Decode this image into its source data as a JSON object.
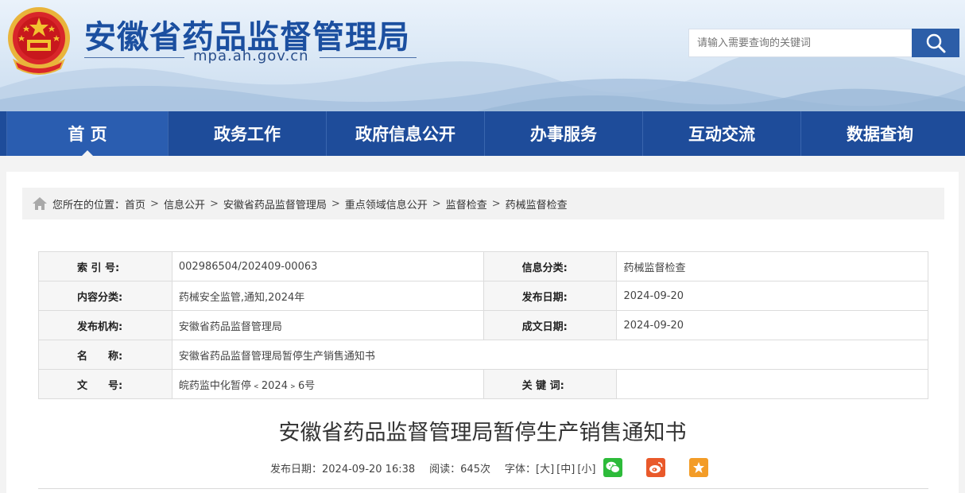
{
  "header": {
    "title": "安徽省药品监督管理局",
    "domain": "mpa.ah.gov.cn",
    "search_placeholder": "请输入需要查询的关键词"
  },
  "nav": {
    "items": [
      {
        "label": "首 页"
      },
      {
        "label": "政务工作"
      },
      {
        "label": "政府信息公开"
      },
      {
        "label": "办事服务"
      },
      {
        "label": "互动交流"
      },
      {
        "label": "数据查询"
      }
    ]
  },
  "breadcrumb": {
    "prefix": "您所在的位置：",
    "sep": ">",
    "items": [
      "首页",
      "信息公开",
      "安徽省药品监督管理局",
      "重点领域信息公开",
      "监督检查",
      "药械监督检查"
    ]
  },
  "meta": {
    "index_label": "索 引 号:",
    "index_value": "002986504/202409-00063",
    "category_label": "信息分类:",
    "category_value": "药械监督检查",
    "content_cat_label": "内容分类:",
    "content_cat_value": "药械安全监管,通知,2024年",
    "publish_date_label": "发布日期:",
    "publish_date_value": "2024-09-20",
    "org_label": "发布机构:",
    "org_value": "安徽省药品监督管理局",
    "made_date_label": "成文日期:",
    "made_date_value": "2024-09-20",
    "name_label": "名　　称:",
    "name_value": "安徽省药品监督管理局暂停生产销售通知书",
    "doc_no_label": "文　　号:",
    "doc_no_value": "皖药监中化暂停﹤2024﹥6号",
    "keywords_label": "关 键 词:",
    "keywords_value": ""
  },
  "article": {
    "title": "安徽省药品监督管理局暂停生产销售通知书",
    "publish": "发布日期：2024-09-20 16:38",
    "reads": "阅读：645次",
    "font_label": "字体：",
    "font_large": "[大]",
    "font_medium": "[中]",
    "font_small": "[小]"
  },
  "colors": {
    "brand_blue": "#1e4c9a",
    "title_blue": "#1b4fa0",
    "wechat": "#2dbb3a",
    "weibo": "#e9592a",
    "favorite": "#f39c27"
  },
  "icons": [
    "national-emblem-icon",
    "search-icon",
    "home-icon",
    "wechat-icon",
    "weibo-icon",
    "star-icon"
  ]
}
